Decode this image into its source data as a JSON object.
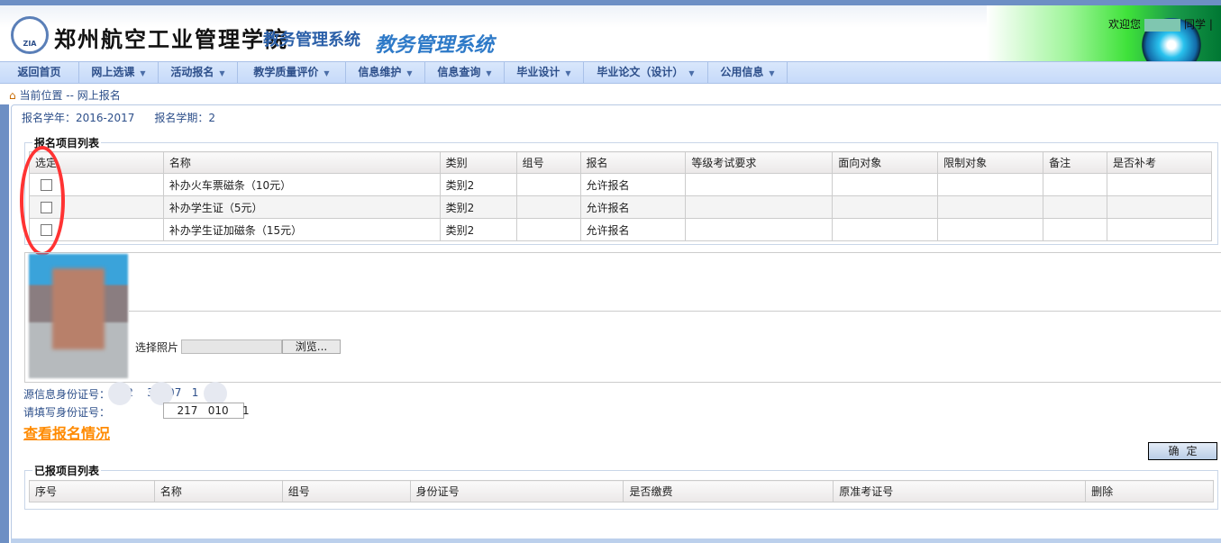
{
  "header": {
    "logo_text": "ZIA",
    "school_name": "郑州航空工业管理学院",
    "system_name": "教务管理系统",
    "system_name_large": "教务管理系统",
    "welcome": "欢迎您",
    "welcome_suffix": "同学 |"
  },
  "nav": [
    {
      "label": "返回首页",
      "dropdown": false
    },
    {
      "label": "网上选课",
      "dropdown": true
    },
    {
      "label": "活动报名",
      "dropdown": true
    },
    {
      "label": "教学质量评价",
      "dropdown": true
    },
    {
      "label": "信息维护",
      "dropdown": true
    },
    {
      "label": "信息查询",
      "dropdown": true
    },
    {
      "label": "毕业设计",
      "dropdown": true
    },
    {
      "label": "毕业论文（设计）",
      "dropdown": true
    },
    {
      "label": "公用信息",
      "dropdown": true
    }
  ],
  "breadcrumb": "当前位置 -- 网上报名",
  "term": {
    "year_label": "报名学年：2016-2017",
    "term_label": "报名学期：2"
  },
  "items_table": {
    "legend": "报名项目列表",
    "columns": [
      "选定",
      "名称",
      "类别",
      "组号",
      "报名",
      "等级考试要求",
      "面向对象",
      "限制对象",
      "备注",
      "是否补考"
    ],
    "rows": [
      {
        "name": "补办火车票磁条（10元）",
        "category": "类别2",
        "group": "",
        "signup": "允许报名",
        "checked": false
      },
      {
        "name": "补办学生证（5元）",
        "category": "类别2",
        "group": "",
        "signup": "允许报名",
        "checked": false
      },
      {
        "name": "补办学生证加磁条（15元）",
        "category": "类别2",
        "group": "",
        "signup": "允许报名",
        "checked": false
      }
    ]
  },
  "photo": {
    "label": "选择照片",
    "browse": "浏览..."
  },
  "id": {
    "source_label": "源信息身份证号：",
    "source_value": "  72    30107   1",
    "input_label": "请填写身份证号：",
    "input_value": "   217   010    1"
  },
  "view_link": "查看报名情况",
  "confirm": "确定",
  "done_table": {
    "legend": "已报项目列表",
    "columns": [
      "序号",
      "名称",
      "组号",
      "身份证号",
      "是否缴费",
      "原准考证号",
      "删除"
    ]
  }
}
